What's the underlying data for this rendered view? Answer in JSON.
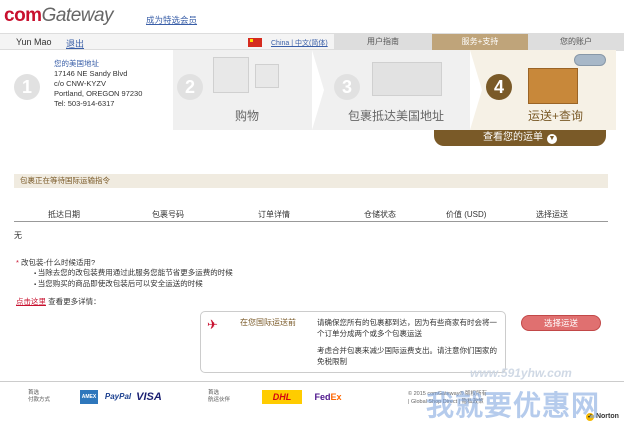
{
  "header": {
    "logo_com": "com",
    "logo_gateway": "Gateway",
    "join_link": "成为特选会员"
  },
  "topbar": {
    "user_name": "Yun Mao",
    "logout": "退出",
    "region": "China | 中文(简体)",
    "nav": {
      "guide": "用户指南",
      "service": "服务+支持",
      "account": "您的账户"
    }
  },
  "steps": {
    "s1": {
      "num": "1",
      "title": "您的美国地址",
      "line1": "17146 NE Sandy Blvd",
      "line2": "c/o CNW-KYZV",
      "line3": "Portland, OREGON 97230",
      "line4": "Tel: 503-914-6317"
    },
    "s2": {
      "num": "2",
      "label": "购物"
    },
    "s3": {
      "num": "3",
      "label": "包裹抵达美国地址"
    },
    "s4": {
      "num": "4",
      "label": "运送+查询"
    }
  },
  "track_button": {
    "label": "查看您的运单",
    "icon": "▼"
  },
  "section_title": "包裹正在等待国际运输指令",
  "table": {
    "headers": [
      "抵达日期",
      "包裹号码",
      "订单详情",
      "仓储状态",
      "价值 (USD)",
      "选择运送"
    ],
    "empty": "无"
  },
  "notes": {
    "question": "改包装-什么时候适用?",
    "items": [
      "当除去您的改包装费用通过此服务您能节省更多运费的时候",
      "当您购买的商品即使改包装后可以安全运送的时候"
    ]
  },
  "details_line": {
    "link": "点击这里",
    "text": "查看更多详情："
  },
  "intl_box": {
    "title": "在您国际运送前",
    "text1": "请确保您所有的包裹都到达，因为有些商家有时会将一个订单分成两个或多个包裹运送",
    "text2": "考虑合并包裹来减少国际运费支出。请注意你们国家的免税限制"
  },
  "select_shipping_button": "选择运送",
  "footer": {
    "payment_label": "首选\n付款方式",
    "amex": "AMEX",
    "paypal": "PayPal",
    "visa": "VISA",
    "shipping_label": "首选\n航运伙伴",
    "dhl": "DHL",
    "fedex_fed": "Fed",
    "fedex_ex": "Ex",
    "copyright": "© 2015 comGateway® 版权所有\n| Global Shop Direct | 隐私政策",
    "norton": "Norton"
  },
  "watermark": {
    "url": "www.591yhw.com",
    "text": "我就要优惠网"
  },
  "colors": {
    "brand_red": "#c8102e",
    "accent_brown": "#7a5a28",
    "accent_tan": "#bfa47a",
    "link_blue": "#3a5fa8"
  }
}
